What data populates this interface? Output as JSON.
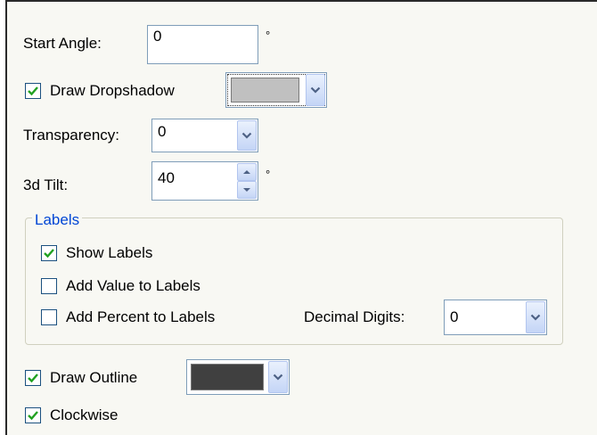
{
  "start_angle": {
    "label": "Start Angle:",
    "value": "0",
    "unit": "°"
  },
  "dropshadow": {
    "label": "Draw Dropshadow",
    "checked": true,
    "color": "#c0c0c0"
  },
  "transparency": {
    "label": "Transparency:",
    "value": "0"
  },
  "tilt": {
    "label": "3d Tilt:",
    "value": "40",
    "unit": "°"
  },
  "labels_group": {
    "title": "Labels",
    "show_labels": {
      "label": "Show Labels",
      "checked": true
    },
    "add_value": {
      "label": "Add Value to Labels",
      "checked": false
    },
    "add_percent": {
      "label": "Add Percent to Labels",
      "checked": false
    },
    "decimal_digits": {
      "label": "Decimal Digits:",
      "value": "0"
    }
  },
  "outline": {
    "label": "Draw Outline",
    "checked": true,
    "color": "#404040"
  },
  "clockwise": {
    "label": "Clockwise",
    "checked": true
  },
  "colors": {
    "check": "#21a121",
    "accent_border": "#7f9db9",
    "group_title": "#0046d5"
  }
}
